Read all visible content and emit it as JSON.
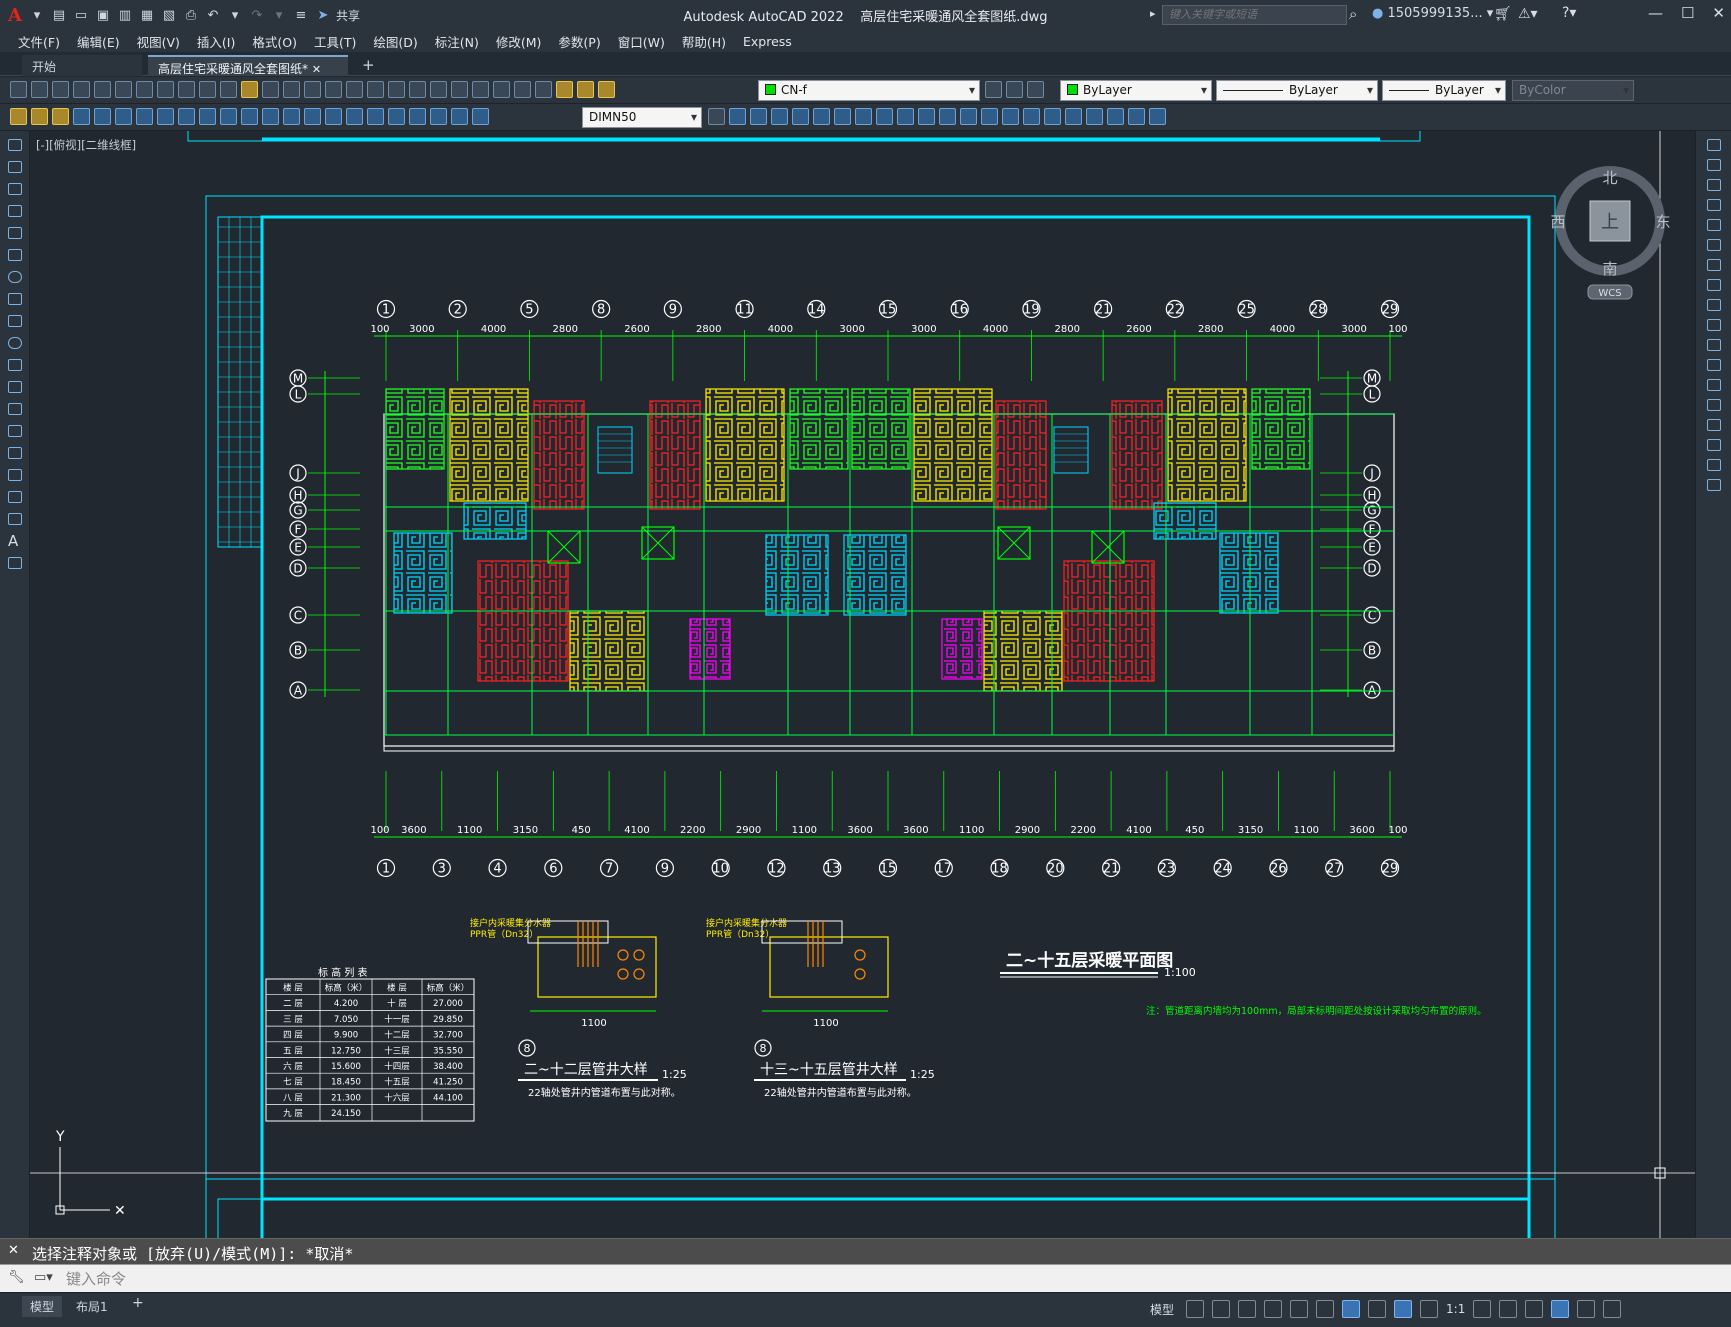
{
  "window": {
    "app_title": "Autodesk AutoCAD 2022",
    "file_title": "高层住宅采暖通风全套图纸.dwg",
    "share_label": "共享",
    "search_placeholder": "键入关键字或短语",
    "user": "1505999135..."
  },
  "menu": [
    "文件(F)",
    "编辑(E)",
    "视图(V)",
    "插入(I)",
    "格式(O)",
    "工具(T)",
    "绘图(D)",
    "标注(N)",
    "修改(M)",
    "参数(P)",
    "窗口(W)",
    "帮助(H)",
    "Express"
  ],
  "tabs": [
    {
      "label": "开始",
      "active": false
    },
    {
      "label": "高层住宅采暖通风全套图纸*",
      "active": true
    }
  ],
  "toolbar": {
    "layer": "CN-f",
    "color": "ByLayer",
    "linetype": "ByLayer",
    "lineweight": "ByLayer",
    "plotstyle": "ByColor",
    "dimstyle": "DIMN50"
  },
  "viewport_label": "[-][俯视][二维线框]",
  "viewcube": {
    "north": "北",
    "south": "南",
    "east": "东",
    "west": "西",
    "face": "上",
    "wcs": "WCS"
  },
  "drawing": {
    "plan_title": "二~十五层采暖平面图",
    "plan_scale": "1:100",
    "note": "注：管道距离内墙均为100mm，局部未标明间距处按设计采取均匀布置的原则。",
    "detail1_title": "二~十二层管井大样",
    "detail1_scale": "1:25",
    "detail1_sub": "22轴处管井内管道布置与此对称。",
    "detail2_title": "十三~十五层管井大样",
    "detail2_scale": "1:25",
    "detail2_sub": "22轴处管井内管道布置与此对称。",
    "detail_label": "接户内采暖集分水器",
    "detail_pipe": "PPR管（Dn32）",
    "top_axes": [
      "1",
      "2",
      "5",
      "8",
      "9",
      "11",
      "14",
      "15",
      "16",
      "19",
      "21",
      "22",
      "25",
      "28",
      "29"
    ],
    "top_dims": [
      "100",
      "3000",
      "4000",
      "2800",
      "2600",
      "2800",
      "4000",
      "3000",
      "3000",
      "4000",
      "2800",
      "2600",
      "2800",
      "4000",
      "3000",
      "100"
    ],
    "bottom_axes": [
      "1",
      "3",
      "4",
      "6",
      "7",
      "9",
      "10",
      "12",
      "13",
      "15",
      "17",
      "18",
      "20",
      "21",
      "23",
      "24",
      "26",
      "27",
      "29"
    ],
    "bottom_dims": [
      "100",
      "3600",
      "1100",
      "3150",
      "450",
      "4100",
      "2200",
      "2900",
      "1100",
      "3600",
      "3600",
      "1100",
      "2900",
      "2200",
      "4100",
      "450",
      "3150",
      "1100",
      "3600",
      "100"
    ],
    "row_axes": [
      "M",
      "L",
      "J",
      "H",
      "G",
      "F",
      "E",
      "D",
      "C",
      "B",
      "A"
    ],
    "table_title": "标 高 列 表",
    "table_headers": [
      "楼 层",
      "标高（米）",
      "楼 层",
      "标高（米）"
    ],
    "table_rows": [
      [
        "二 层",
        "4.200",
        "十 层",
        "27.000"
      ],
      [
        "三 层",
        "7.050",
        "十一层",
        "29.850"
      ],
      [
        "四 层",
        "9.900",
        "十二层",
        "32.700"
      ],
      [
        "五 层",
        "12.750",
        "十三层",
        "35.550"
      ],
      [
        "六 层",
        "15.600",
        "十四层",
        "38.400"
      ],
      [
        "七 层",
        "18.450",
        "十五层",
        "41.250"
      ],
      [
        "八 层",
        "21.300",
        "十六层",
        "44.100"
      ],
      [
        "九 层",
        "24.150",
        "",
        ""
      ]
    ]
  },
  "command": {
    "history": "选择注释对象或 [放弃(U)/模式(M)]: *取消*",
    "placeholder": "键入命令"
  },
  "status": {
    "model_tab": "模型",
    "layout_tab": "布局1",
    "model_button": "模型",
    "scale": "1:1"
  },
  "colors": {
    "canvas_bg": "#212830",
    "frame": "#00e5ff",
    "grid_lines": "#00ff00",
    "annotation_text": "#ffff00",
    "room_red": "#ff2020",
    "room_cyan": "#00d7ff",
    "room_yellow": "#ffee00",
    "room_magenta": "#ff00ff"
  }
}
